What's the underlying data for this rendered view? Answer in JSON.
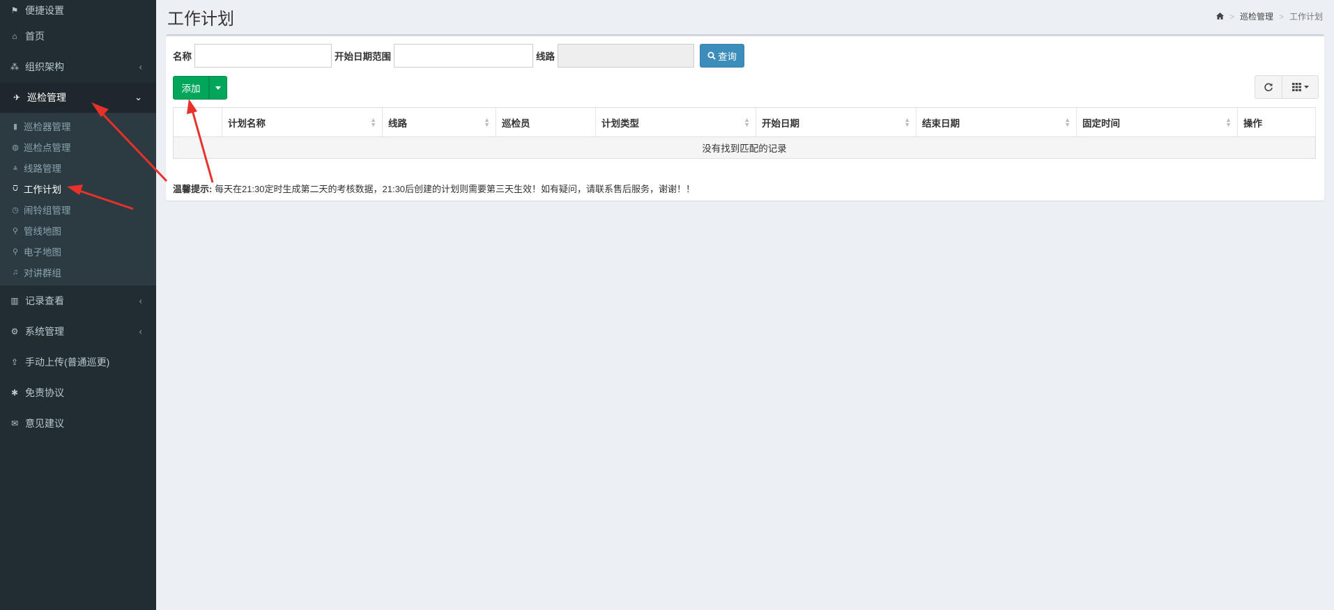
{
  "sidebar": {
    "items": [
      {
        "label": "便捷设置",
        "icon": "flag-icon",
        "glyph": "⚑"
      },
      {
        "label": "首页",
        "icon": "home-icon",
        "glyph": "⌂"
      },
      {
        "label": "组织架构",
        "icon": "sitemap-icon",
        "glyph": "⁂"
      },
      {
        "label": "巡检管理",
        "icon": "motorcycle-icon",
        "glyph": "✈"
      },
      {
        "label": "记录查看",
        "icon": "bar-chart-icon",
        "glyph": "▥"
      },
      {
        "label": "系统管理",
        "icon": "gear-icon",
        "glyph": "⚙"
      },
      {
        "label": "手动上传(普通巡更)",
        "icon": "upload-icon",
        "glyph": "⇪"
      },
      {
        "label": "免责协议",
        "icon": "asterisk-icon",
        "glyph": "✱"
      },
      {
        "label": "意见建议",
        "icon": "envelope-open-icon",
        "glyph": "✉"
      }
    ],
    "submenu": [
      {
        "label": "巡检器管理",
        "icon": "book-icon",
        "glyph": "▮"
      },
      {
        "label": "巡检点管理",
        "icon": "map-marker-icon",
        "glyph": "◍"
      },
      {
        "label": "线路管理",
        "icon": "road-icon",
        "glyph": "⩓"
      },
      {
        "label": "工作计划",
        "icon": "basket-icon",
        "glyph": "⩂"
      },
      {
        "label": "闹铃组管理",
        "icon": "clock-icon",
        "glyph": "◷"
      },
      {
        "label": "管线地图",
        "icon": "location-icon",
        "glyph": "⚲"
      },
      {
        "label": "电子地图",
        "icon": "pushpin-icon",
        "glyph": "⚲"
      },
      {
        "label": "对讲群组",
        "icon": "microphone-icon",
        "glyph": "♫"
      }
    ],
    "chevron_left": "‹",
    "chevron_down": "⌄"
  },
  "header": {
    "title": "工作计划",
    "breadcrumb": [
      "巡检管理",
      "工作计划"
    ],
    "breadcrumb_sep": ">"
  },
  "search": {
    "name_label": "名称",
    "name_value": "",
    "date_label": "开始日期范围",
    "date_value": "",
    "line_label": "线路",
    "line_value": "",
    "query_label": "查询"
  },
  "toolbar": {
    "add_label": "添加"
  },
  "table": {
    "columns": [
      "计划名称",
      "线路",
      "巡检员",
      "计划类型",
      "开始日期",
      "结束日期",
      "固定时间",
      "操作"
    ],
    "empty_text": "没有找到匹配的记录"
  },
  "tip": {
    "label": "温馨提示:",
    "text": "每天在21:30定时生成第二天的考核数据，21:30后创建的计划则需要第三天生效！如有疑问，请联系售后服务，谢谢！！"
  },
  "colors": {
    "sidebar_bg": "#222d32",
    "submenu_bg": "#2c3b41",
    "primary": "#3c8dbc",
    "success": "#00a65a",
    "annotation": "#e8312a"
  }
}
